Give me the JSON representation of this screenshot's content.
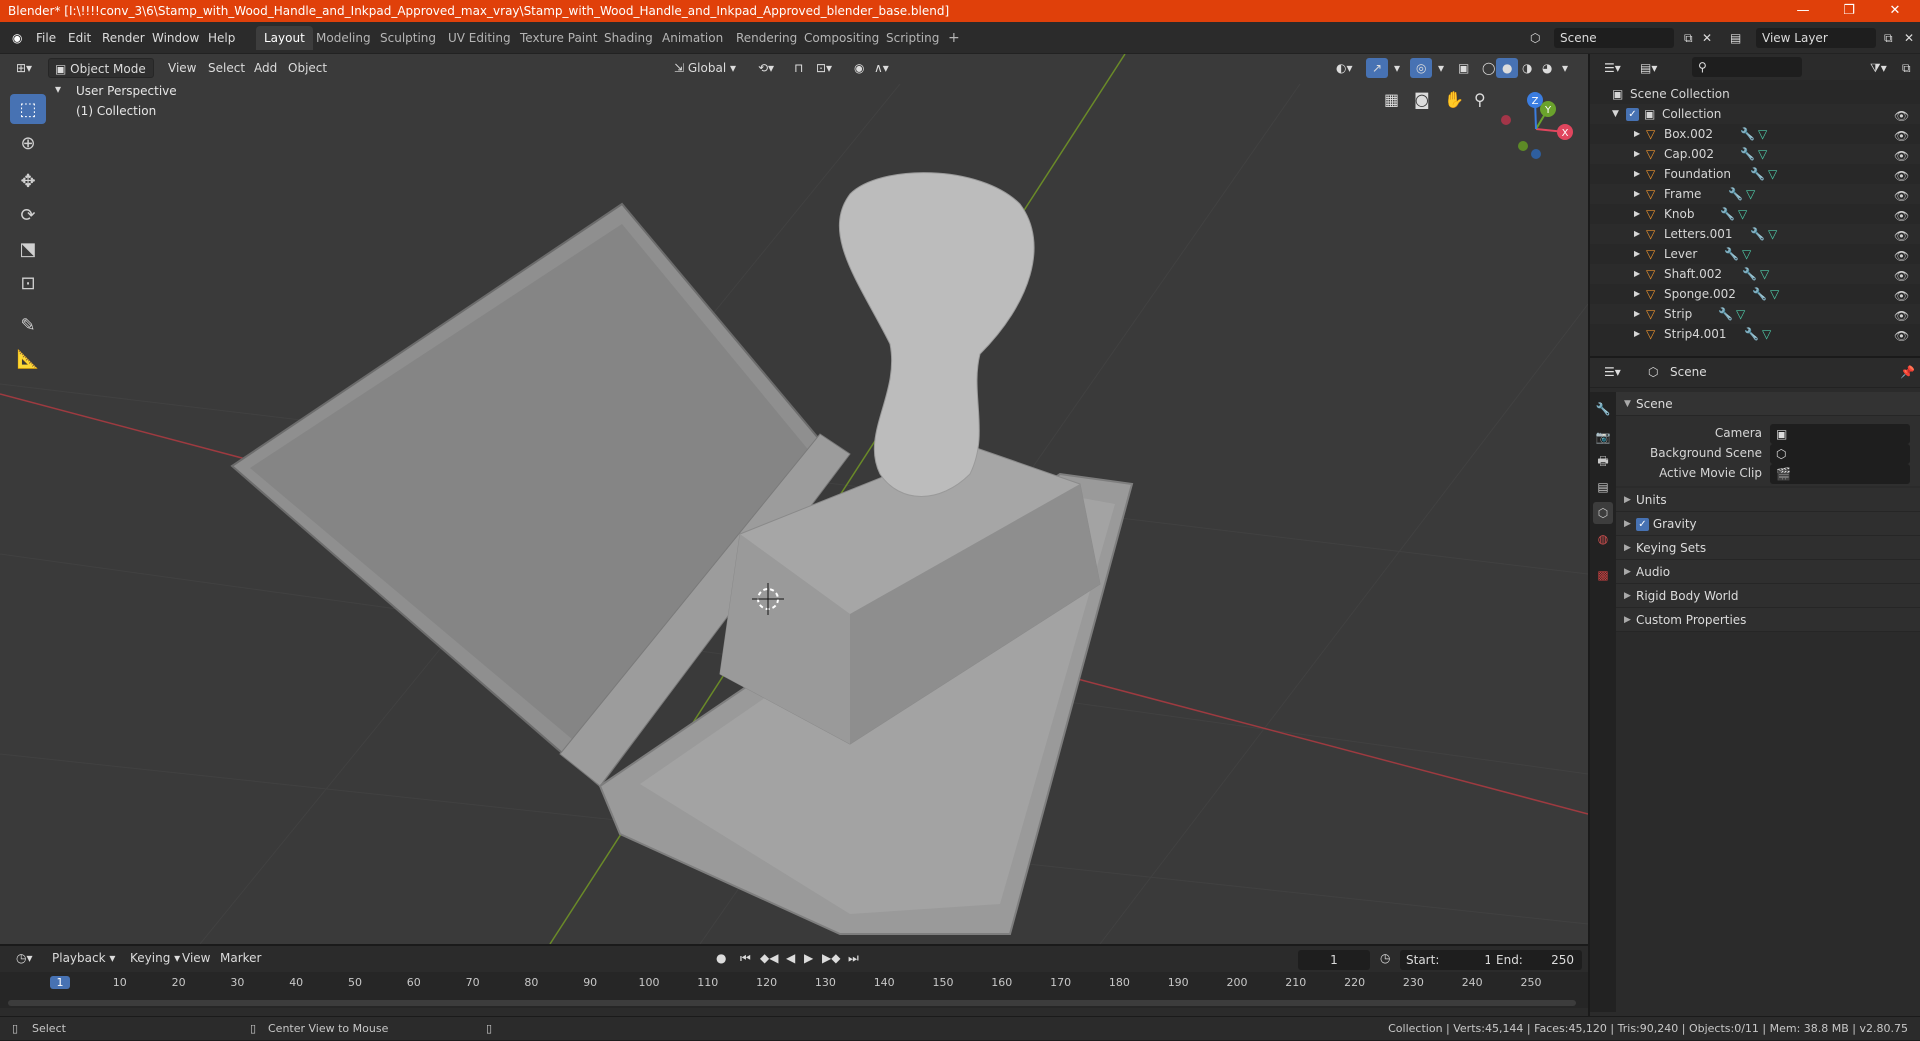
{
  "window": {
    "title": "Blender* [I:\\!!!!conv_3\\6\\Stamp_with_Wood_Handle_and_Inkpad_Approved_max_vray\\Stamp_with_Wood_Handle_and_Inkpad_Approved_blender_base.blend]",
    "minimize": "—",
    "restore": "❐",
    "close": "✕"
  },
  "menu": [
    "File",
    "Edit",
    "Render",
    "Window",
    "Help"
  ],
  "workspaces": [
    "Layout",
    "Modeling",
    "Sculpting",
    "UV Editing",
    "Texture Paint",
    "Shading",
    "Animation",
    "Rendering",
    "Compositing",
    "Scripting"
  ],
  "add_workspace": "+",
  "scene_field": "Scene",
  "view_layer_field": "View Layer",
  "viewport": {
    "mode": "Object Mode",
    "menus": [
      "View",
      "Select",
      "Add",
      "Object"
    ],
    "transform_orientation": "Global",
    "overlay_text_1": "User Perspective",
    "overlay_text_2": "(1) Collection",
    "gizmo": {
      "x": "X",
      "y": "Y",
      "z": "Z"
    }
  },
  "outliner": {
    "root": "Scene Collection",
    "collection": "Collection",
    "objects": [
      "Box.002",
      "Cap.002",
      "Foundation",
      "Frame",
      "Knob",
      "Letters.001",
      "Lever",
      "Shaft.002",
      "Sponge.002",
      "Strip",
      "Strip4.001"
    ]
  },
  "properties": {
    "context": "Scene",
    "section": "Scene",
    "camera_label": "Camera",
    "background_scene_label": "Background Scene",
    "active_movie_clip_label": "Active Movie Clip",
    "panels": [
      "Units",
      "Gravity",
      "Keying Sets",
      "Audio",
      "Rigid Body World",
      "Custom Properties"
    ],
    "gravity_checked": true
  },
  "timeline": {
    "menus": [
      "Playback",
      "Keying",
      "View",
      "Marker"
    ],
    "current_frame": "1",
    "start_label": "Start:",
    "start_value": "1",
    "end_label": "End:",
    "end_value": "250",
    "ruler": [
      "1",
      "10",
      "20",
      "30",
      "40",
      "50",
      "60",
      "70",
      "80",
      "90",
      "100",
      "110",
      "120",
      "130",
      "140",
      "150",
      "160",
      "170",
      "180",
      "190",
      "200",
      "210",
      "220",
      "230",
      "240",
      "250"
    ]
  },
  "status": {
    "left_1": "Select",
    "left_2": "Center View to Mouse",
    "right": "Collection | Verts:45,144 | Faces:45,120 | Tris:90,240 | Objects:0/11 | Mem: 38.8 MB | v2.80.75"
  }
}
